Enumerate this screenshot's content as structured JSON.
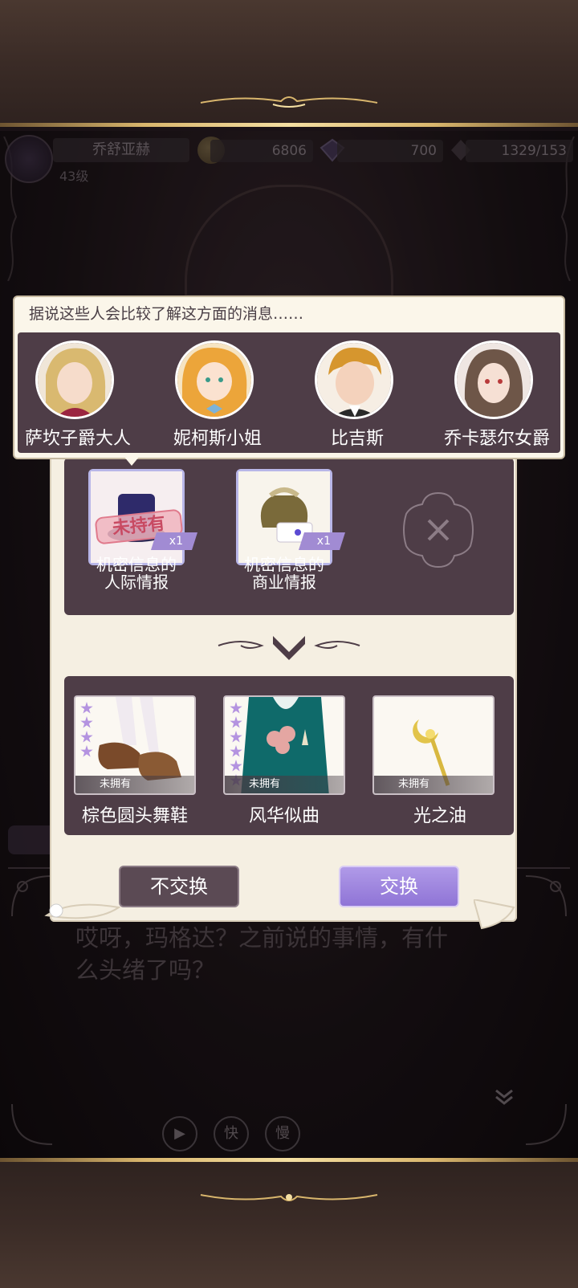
{
  "hud": {
    "player_name": "乔舒亚赫",
    "level": "43级",
    "coins": "6806",
    "gems": "700",
    "stamina": "1329/153"
  },
  "tooltip": {
    "title": "据说这些人会比较了解这方面的消息……",
    "characters": [
      {
        "name": "萨坎子爵大人"
      },
      {
        "name": "妮柯斯小姐"
      },
      {
        "name": "比吉斯"
      },
      {
        "name": "乔卡瑟尔女爵"
      }
    ]
  },
  "exchange": {
    "inputs": [
      {
        "label_line1": "机密信息的",
        "label_line2": "人际情报",
        "quantity": "x1",
        "stamp": "未持有"
      },
      {
        "label_line1": "机密信息的",
        "label_line2": "商业情报",
        "quantity": "x1"
      }
    ],
    "rewards": [
      {
        "name": "棕色圆头舞鞋",
        "status": "未拥有",
        "stars": 4
      },
      {
        "name": "风华似曲",
        "status": "未拥有",
        "stars": 6
      },
      {
        "name": "光之油",
        "status": "未拥有",
        "stars": 0
      }
    ],
    "reject_label": "不交换",
    "confirm_label": "交换"
  },
  "dialogue": {
    "line1": "哎呀，玛格达？之前说的事情，有什",
    "line2": "么头绪了吗？"
  },
  "controls": {
    "play_label": "▶",
    "fast_label": "快",
    "slow_label": "慢"
  },
  "colors": {
    "panel": "#4e3d47",
    "parchment": "#f5efe2",
    "accent": "#a18bd3",
    "gold": "#d9b66d"
  }
}
